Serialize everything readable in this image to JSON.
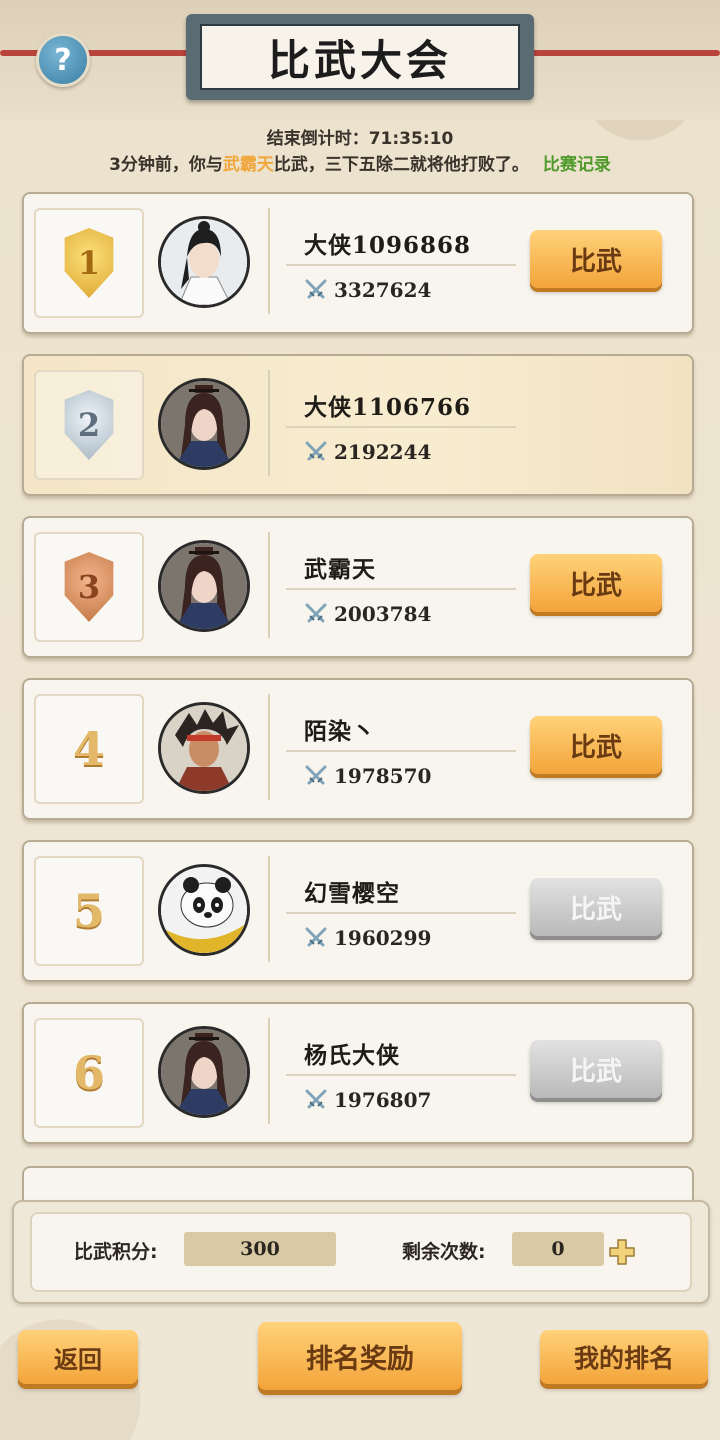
{
  "header": {
    "title": "比武大会",
    "help_label": "?",
    "countdown_label": "结束倒计时：",
    "countdown_value": "71:35:10",
    "news": {
      "prefix": "3分钟前，你与",
      "opponent": "武霸天",
      "suffix": "比武，三下五除二就将他打败了。",
      "record_link": "比赛记录"
    }
  },
  "players": [
    {
      "rank": "1",
      "medal": "gold",
      "name": "大侠1096868",
      "power": "3327624",
      "button": "比武",
      "button_state": "active",
      "avatar": "swordsman-white"
    },
    {
      "rank": "2",
      "medal": "silver",
      "name": "大侠1106766",
      "power": "2192244",
      "button": "",
      "button_state": "none",
      "avatar": "swordswoman",
      "highlight": true
    },
    {
      "rank": "3",
      "medal": "bronze",
      "name": "武霸天",
      "power": "2003784",
      "button": "比武",
      "button_state": "active",
      "avatar": "swordswoman"
    },
    {
      "rank": "4",
      "medal": "",
      "name": "陌染丶",
      "power": "1978570",
      "button": "比武",
      "button_state": "active",
      "avatar": "warrior-headband"
    },
    {
      "rank": "5",
      "medal": "",
      "name": "幻雪樱空",
      "power": "1960299",
      "button": "比武",
      "button_state": "disabled",
      "avatar": "panda"
    },
    {
      "rank": "6",
      "medal": "",
      "name": "杨氏大侠",
      "power": "1976807",
      "button": "比武",
      "button_state": "disabled",
      "avatar": "swordswoman"
    }
  ],
  "score_panel": {
    "points_label": "比武积分:",
    "points_value": "300",
    "remaining_label": "剩余次数:",
    "remaining_value": "0"
  },
  "bottom_bar": {
    "back": "返回",
    "rewards": "排名奖励",
    "my_rank": "我的排名"
  },
  "colors": {
    "accent_orange": "#f3a43a",
    "highlight_name": "#f0a63a",
    "link_green": "#4e9a2a",
    "disabled_gray": "#b9b9b9"
  }
}
